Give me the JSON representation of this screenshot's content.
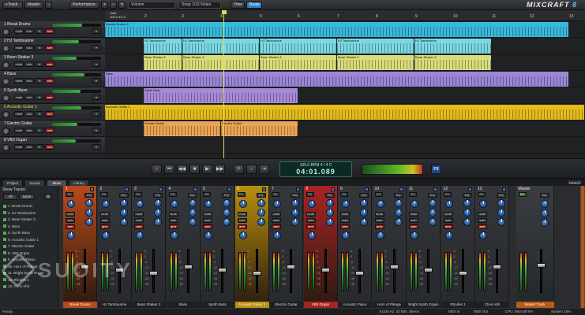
{
  "toolbar": {
    "track_btn": "+Track",
    "master_btn": "Master",
    "performance_btn": "Performance",
    "volume_select": "Volume",
    "snap_select": "Snap 1/16 Notes",
    "time_btn": "Time",
    "beats_btn": "Beats",
    "logo_a": "MIXCRAFT",
    "logo_b": "8"
  },
  "ruler": {
    "start": "Start",
    "start_info": "105.0 4/4 C",
    "marks": [
      "2",
      "3",
      "4",
      "5",
      "6",
      "7",
      "8",
      "9",
      "10",
      "11",
      "12",
      "13"
    ]
  },
  "tracks": [
    {
      "name": "1 Break Drums",
      "color": "#2fb8d8",
      "vol": 0.62
    },
    {
      "name": "2 HJ Tambourine",
      "color": "#6fd6e0",
      "vol": 0.55
    },
    {
      "name": "3 Bean Shaker 3",
      "color": "#d8dc7a",
      "vol": 0.5
    },
    {
      "name": "4 Bass",
      "color": "#9a82d8",
      "vol": 0.66
    },
    {
      "name": "5 Synth Bass",
      "color": "#a68ad8",
      "vol": 0.58
    },
    {
      "name": "6 Acoustic Guitar 1",
      "color": "#e0b818",
      "vol": 0.6
    },
    {
      "name": "7 Electric Guitar",
      "color": "#e8a050",
      "vol": 0.52
    },
    {
      "name": "8 VB3 Organ",
      "color": "#d84848",
      "vol": 0.48
    }
  ],
  "track_buttons": {
    "mute": "mute",
    "solo": "solo",
    "fx": "fx",
    "arm": "arm"
  },
  "clip_labels": {
    "break_drums": "Breaks Drums 2",
    "tambourine": "HJ Tambourine",
    "shaker": "Bean Shaker 3",
    "bass": "Bass",
    "synth_bass": "Synth Bass",
    "acoustic": "Acoustic Guitar 1",
    "electric": "Electric Guitar"
  },
  "transport": {
    "bpm_line": "105.0 BPM   4 / 4    C",
    "position": "04:01.089",
    "fx": "FX"
  },
  "tabs": [
    "Project",
    "Sound",
    "Mixer",
    "Library"
  ],
  "active_tab": "Mixer",
  "detach": "Detach",
  "show_tracks": {
    "header": "Show Tracks:",
    "all": "All",
    "none": "None",
    "items": [
      "1. Break Drums",
      "2. HJ Tambourine",
      "3. Bean Shaker 3",
      "4. Bass",
      "5. Synth Bass",
      "6. Acoustic Guitar 1",
      "7. Electric Guitar",
      "8. VB3 Organ",
      "9. Acoustic Piano",
      "10. Horn of Plange",
      "11. Bright Synth Organ",
      "12. Rhodes 1",
      "13. Choir Ahh"
    ]
  },
  "mixer": {
    "strips": [
      {
        "num": "1",
        "name": "Break Drums",
        "color": "#b84a1a"
      },
      {
        "num": "2",
        "name": "HJ Tambourine",
        "color": ""
      },
      {
        "num": "3",
        "name": "Bean Shaker 3",
        "color": ""
      },
      {
        "num": "4",
        "name": "Bass",
        "color": ""
      },
      {
        "num": "5",
        "name": "Synth Bass",
        "color": ""
      },
      {
        "num": "6",
        "name": "Acoustic Guitar 1",
        "color": "#b8900e"
      },
      {
        "num": "7",
        "name": "Electric Guitar",
        "color": ""
      },
      {
        "num": "8",
        "name": "VB3 Organ",
        "color": "#a82424"
      },
      {
        "num": "9",
        "name": "Acoustic Piano",
        "color": ""
      },
      {
        "num": "10",
        "name": "Horn of Plange",
        "color": ""
      },
      {
        "num": "11",
        "name": "Bright Synth Organ",
        "color": ""
      },
      {
        "num": "12",
        "name": "Rhodes 1",
        "color": ""
      },
      {
        "num": "13",
        "name": "Choir Ahh",
        "color": ""
      }
    ],
    "master": "Master",
    "master_track": "Master Track",
    "strip_labels": {
      "eq": "EQ",
      "mute": "mute",
      "solo": "solo",
      "arm": "arm",
      "fx": "FX"
    },
    "scale": [
      "6",
      "0",
      "-6",
      "-12",
      "-24",
      "-36",
      "-48"
    ]
  },
  "watermark": "SUOITY",
  "status": {
    "ready": "Ready",
    "format": "44100 Hz, 32 Bits, Stereo",
    "midi_in": "MIDI In",
    "midi_out": "MIDI Out",
    "cpu": "CPU: Mixcraft 9%",
    "system": "System 15%"
  }
}
